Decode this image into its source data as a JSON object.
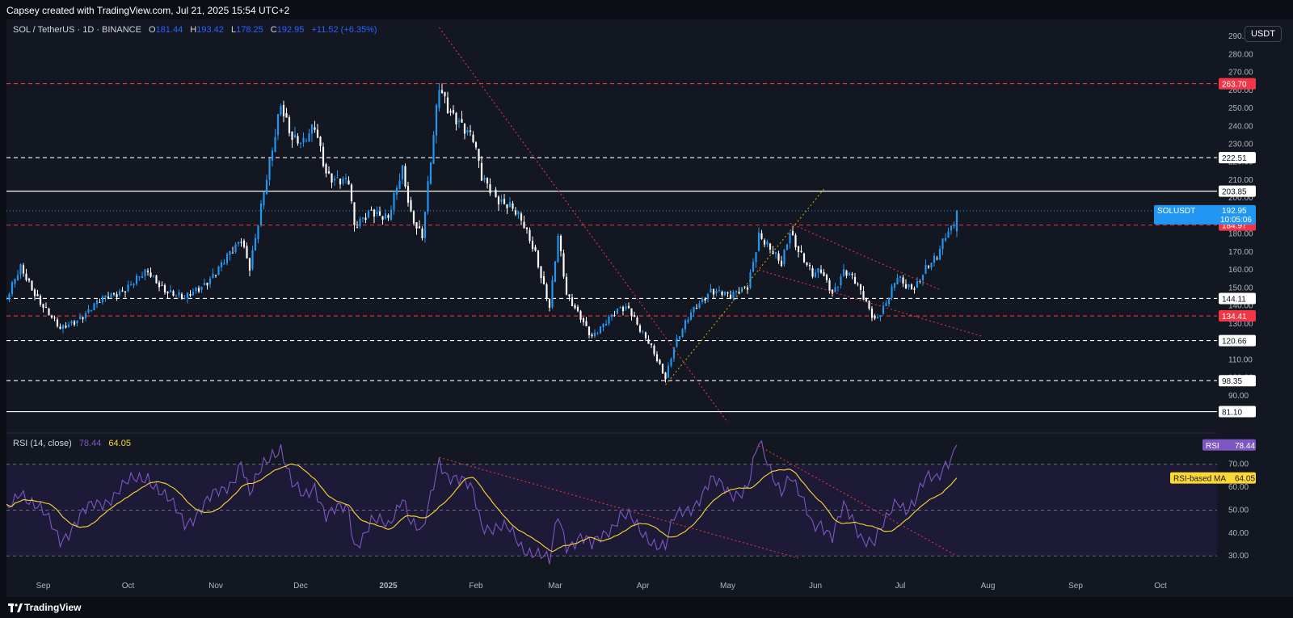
{
  "header": {
    "credit": "Capsey created with TradingView.com, Jul 21, 2025 15:54 UTC+2"
  },
  "instrument": {
    "title": "SOL / TetherUS · 1D · BINANCE",
    "o_label": "O",
    "o": "181.44",
    "h_label": "H",
    "h": "193.42",
    "l_label": "L",
    "l": "178.25",
    "c_label": "C",
    "c": "192.95",
    "change": "+11.52 (+6.35%)"
  },
  "currency_button": "USDT",
  "rsi_header": {
    "title": "RSI (14, close)",
    "rsi": "78.44",
    "ma": "64.05"
  },
  "footer": {
    "brand": "TradingView"
  },
  "colors": {
    "bg": "#131722",
    "up": "#2196f3",
    "down": "#ffffff",
    "red_level": "#f23645",
    "rsi": "#7e57c2",
    "rsi_ma": "#fdd835"
  },
  "chart_data": [
    {
      "type": "candlestick",
      "title": "SOL / TetherUS · 1D · BINANCE",
      "ylim": [
        80,
        295
      ],
      "y_ticks": [
        90,
        100,
        110,
        120,
        130,
        140,
        150,
        160,
        170,
        180,
        190,
        200,
        210,
        220,
        230,
        240,
        250,
        260,
        270,
        280,
        290
      ],
      "x_ticks": [
        "Sep",
        "Oct",
        "Nov",
        "Dec",
        "2025",
        "Feb",
        "Mar",
        "Apr",
        "May",
        "Jun",
        "Jul",
        "Aug",
        "Sep",
        "Oct"
      ],
      "x_tick_dates": [
        "2024-09-01",
        "2024-10-01",
        "2024-11-01",
        "2024-12-01",
        "2025-01-01",
        "2025-02-01",
        "2025-03-01",
        "2025-04-01",
        "2025-05-01",
        "2025-06-01",
        "2025-07-01",
        "2025-08-01",
        "2025-09-01",
        "2025-10-01"
      ],
      "x_range": [
        "2024-08-19",
        "2025-10-21"
      ],
      "anchors": [
        [
          "2024-08-19",
          144
        ],
        [
          "2024-08-24",
          160
        ],
        [
          "2024-09-07",
          126
        ],
        [
          "2024-09-19",
          140
        ],
        [
          "2024-10-08",
          158
        ],
        [
          "2024-10-14",
          150
        ],
        [
          "2024-10-21",
          143
        ],
        [
          "2024-11-03",
          162
        ],
        [
          "2024-11-07",
          170
        ],
        [
          "2024-11-10",
          178
        ],
        [
          "2024-11-13",
          163
        ],
        [
          "2024-11-18",
          202
        ],
        [
          "2024-11-21",
          225
        ],
        [
          "2024-11-24",
          253
        ],
        [
          "2024-11-28",
          236
        ],
        [
          "2024-12-02",
          230
        ],
        [
          "2024-12-06",
          238
        ],
        [
          "2024-12-10",
          215
        ],
        [
          "2024-12-18",
          208
        ],
        [
          "2024-12-20",
          182
        ],
        [
          "2024-12-26",
          195
        ],
        [
          "2025-01-01",
          188
        ],
        [
          "2025-01-06",
          215
        ],
        [
          "2025-01-09",
          192
        ],
        [
          "2025-01-13",
          180
        ],
        [
          "2025-01-19",
          260
        ],
        [
          "2025-01-22",
          250
        ],
        [
          "2025-01-26",
          245
        ],
        [
          "2025-01-31",
          232
        ],
        [
          "2025-02-03",
          210
        ],
        [
          "2025-02-08",
          202
        ],
        [
          "2025-02-13",
          196
        ],
        [
          "2025-02-17",
          186
        ],
        [
          "2025-02-22",
          170
        ],
        [
          "2025-02-27",
          140
        ],
        [
          "2025-03-02",
          178
        ],
        [
          "2025-03-05",
          145
        ],
        [
          "2025-03-10",
          135
        ],
        [
          "2025-03-14",
          123
        ],
        [
          "2025-03-18",
          128
        ],
        [
          "2025-03-24",
          140
        ],
        [
          "2025-03-27",
          140
        ],
        [
          "2025-03-31",
          126
        ],
        [
          "2025-04-04",
          116
        ],
        [
          "2025-04-09",
          101
        ],
        [
          "2025-04-12",
          118
        ],
        [
          "2025-04-18",
          135
        ],
        [
          "2025-04-25",
          150
        ],
        [
          "2025-04-28",
          148
        ],
        [
          "2025-05-02",
          144
        ],
        [
          "2025-05-08",
          152
        ],
        [
          "2025-05-12",
          180
        ],
        [
          "2025-05-16",
          170
        ],
        [
          "2025-05-20",
          163
        ],
        [
          "2025-05-23",
          183
        ],
        [
          "2025-05-26",
          172
        ],
        [
          "2025-05-31",
          156
        ],
        [
          "2025-06-03",
          159
        ],
        [
          "2025-06-07",
          148
        ],
        [
          "2025-06-11",
          160
        ],
        [
          "2025-06-14",
          155
        ],
        [
          "2025-06-17",
          147
        ],
        [
          "2025-06-22",
          133
        ],
        [
          "2025-06-26",
          142
        ],
        [
          "2025-06-30",
          155
        ],
        [
          "2025-07-03",
          150
        ],
        [
          "2025-07-06",
          151
        ],
        [
          "2025-07-10",
          162
        ],
        [
          "2025-07-14",
          166
        ],
        [
          "2025-07-17",
          178
        ],
        [
          "2025-07-19",
          183
        ],
        [
          "2025-07-21",
          193
        ]
      ],
      "last_close": 192.95,
      "levels": [
        {
          "price": 263.7,
          "label": "263.70",
          "style": "red-dashed"
        },
        {
          "price": 222.51,
          "label": "222.51",
          "style": "white-dashed"
        },
        {
          "price": 203.85,
          "label": "203.85",
          "style": "white-solid"
        },
        {
          "price": 184.97,
          "label": "184.97",
          "style": "red-dashed"
        },
        {
          "price": 144.11,
          "label": "144.11",
          "style": "white-dashed"
        },
        {
          "price": 134.41,
          "label": "134.41",
          "style": "red-dashed"
        },
        {
          "price": 120.66,
          "label": "120.66",
          "style": "white-dashed"
        },
        {
          "price": 98.35,
          "label": "98.35",
          "style": "white-dashed"
        },
        {
          "price": 81.1,
          "label": "81.10",
          "style": "white-solid"
        }
      ],
      "last_price_label": {
        "symbol": "SOLUSDT",
        "price": "192.95",
        "countdown": "10:05:06"
      },
      "trendlines": [
        {
          "from": [
            "2025-01-19",
            295
          ],
          "to": [
            "2025-05-01",
            75
          ],
          "style": "red-dotted"
        },
        {
          "from": [
            "2025-04-09",
            96
          ],
          "to": [
            "2025-06-04",
            205
          ],
          "style": "yellow-dotted"
        },
        {
          "from": [
            "2025-05-23",
            186
          ],
          "to": [
            "2025-07-15",
            149
          ],
          "style": "red-dotted"
        },
        {
          "from": [
            "2025-05-12",
            160
          ],
          "to": [
            "2025-07-30",
            123
          ],
          "style": "red-dotted"
        }
      ]
    },
    {
      "type": "line",
      "title": "RSI (14, close)",
      "ylim": [
        23,
        84
      ],
      "y_ticks": [
        30,
        40,
        50,
        60,
        70
      ],
      "bands": [
        30,
        50,
        70
      ],
      "series": [
        {
          "name": "RSI",
          "last": 78.44,
          "anchors": [
            [
              "2024-08-19",
              48
            ],
            [
              "2024-08-24",
              60
            ],
            [
              "2024-09-07",
              38
            ],
            [
              "2024-09-19",
              52
            ],
            [
              "2024-10-08",
              66
            ],
            [
              "2024-10-14",
              55
            ],
            [
              "2024-10-21",
              45
            ],
            [
              "2024-11-03",
              58
            ],
            [
              "2024-11-07",
              64
            ],
            [
              "2024-11-10",
              72
            ],
            [
              "2024-11-13",
              55
            ],
            [
              "2024-11-18",
              70
            ],
            [
              "2024-11-21",
              76
            ],
            [
              "2024-11-24",
              78
            ],
            [
              "2024-11-28",
              60
            ],
            [
              "2024-12-02",
              55
            ],
            [
              "2024-12-06",
              62
            ],
            [
              "2024-12-10",
              48
            ],
            [
              "2024-12-18",
              50
            ],
            [
              "2024-12-20",
              35
            ],
            [
              "2024-12-26",
              45
            ],
            [
              "2025-01-01",
              42
            ],
            [
              "2025-01-06",
              58
            ],
            [
              "2025-01-09",
              45
            ],
            [
              "2025-01-13",
              38
            ],
            [
              "2025-01-19",
              73
            ],
            [
              "2025-01-22",
              66
            ],
            [
              "2025-01-26",
              62
            ],
            [
              "2025-01-31",
              58
            ],
            [
              "2025-02-03",
              45
            ],
            [
              "2025-02-08",
              42
            ],
            [
              "2025-02-13",
              40
            ],
            [
              "2025-02-17",
              35
            ],
            [
              "2025-02-22",
              32
            ],
            [
              "2025-02-27",
              26
            ],
            [
              "2025-03-02",
              48
            ],
            [
              "2025-03-05",
              36
            ],
            [
              "2025-03-10",
              38
            ],
            [
              "2025-03-14",
              33
            ],
            [
              "2025-03-18",
              40
            ],
            [
              "2025-03-24",
              48
            ],
            [
              "2025-03-27",
              46
            ],
            [
              "2025-03-31",
              40
            ],
            [
              "2025-04-04",
              38
            ],
            [
              "2025-04-09",
              34
            ],
            [
              "2025-04-12",
              45
            ],
            [
              "2025-04-18",
              52
            ],
            [
              "2025-04-25",
              62
            ],
            [
              "2025-04-28",
              60
            ],
            [
              "2025-05-02",
              58
            ],
            [
              "2025-05-08",
              60
            ],
            [
              "2025-05-12",
              78
            ],
            [
              "2025-05-16",
              68
            ],
            [
              "2025-05-20",
              60
            ],
            [
              "2025-05-23",
              65
            ],
            [
              "2025-05-26",
              56
            ],
            [
              "2025-05-31",
              44
            ],
            [
              "2025-06-03",
              46
            ],
            [
              "2025-06-07",
              38
            ],
            [
              "2025-06-11",
              50
            ],
            [
              "2025-06-14",
              46
            ],
            [
              "2025-06-17",
              40
            ],
            [
              "2025-06-22",
              36
            ],
            [
              "2025-06-26",
              44
            ],
            [
              "2025-06-30",
              55
            ],
            [
              "2025-07-03",
              52
            ],
            [
              "2025-07-06",
              54
            ],
            [
              "2025-07-10",
              62
            ],
            [
              "2025-07-14",
              64
            ],
            [
              "2025-07-17",
              72
            ],
            [
              "2025-07-19",
              74
            ],
            [
              "2025-07-21",
              78.44
            ]
          ]
        },
        {
          "name": "RSI-based MA",
          "last": 64.05
        }
      ],
      "tags": [
        {
          "name": "RSI",
          "value": "78.44",
          "color": "#7e57c2"
        },
        {
          "name": "RSI-based MA",
          "value": "64.05",
          "color": "#fdd835"
        }
      ],
      "trendlines": [
        {
          "from": [
            "2025-01-19",
            73
          ],
          "to": [
            "2025-05-26",
            29
          ],
          "style": "red-dotted"
        },
        {
          "from": [
            "2025-05-12",
            78
          ],
          "to": [
            "2025-07-21",
            30
          ],
          "style": "red-dotted"
        }
      ]
    }
  ]
}
